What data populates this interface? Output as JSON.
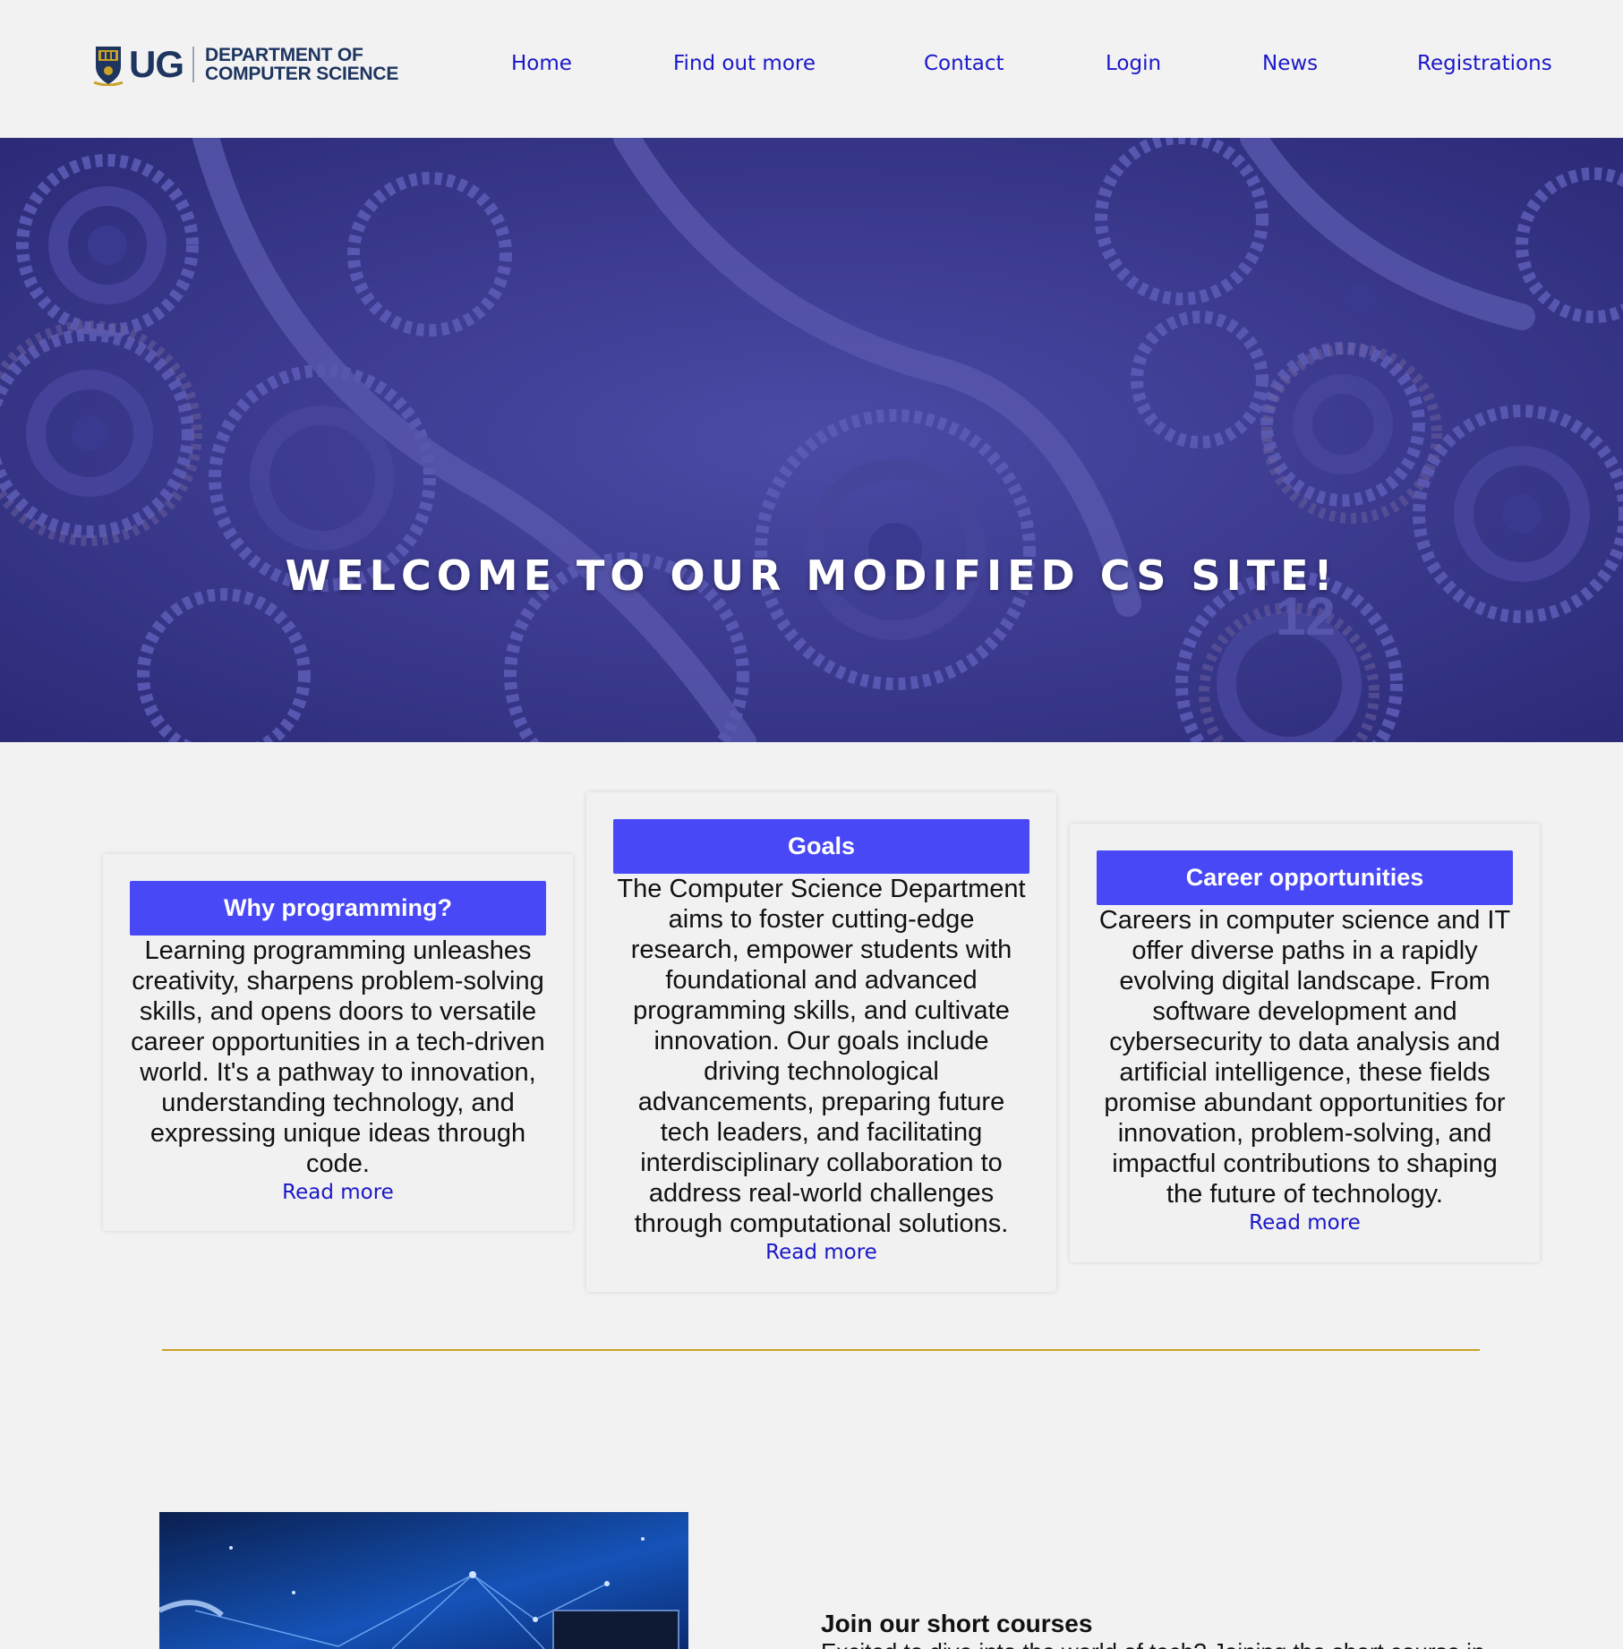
{
  "logo": {
    "mark": "UG",
    "line1": "DEPARTMENT OF",
    "line2": "COMPUTER SCIENCE",
    "crest_icon": "university-crest-icon"
  },
  "nav": {
    "items": [
      {
        "label": "Home"
      },
      {
        "label": "Find out more"
      },
      {
        "label": "Contact"
      },
      {
        "label": "Login"
      },
      {
        "label": "News"
      },
      {
        "label": "Registrations"
      }
    ]
  },
  "hero": {
    "title": "WELCOME TO OUR MODIFIED CS SITE!",
    "background": "gears-image"
  },
  "cards": [
    {
      "title": "Why programming?",
      "body": "Learning programming unleashes creativity, sharpens problem-solving skills, and opens doors to versatile career opportunities in a tech-driven world. It's a pathway to innovation, understanding technology, and expressing unique ideas through code.",
      "link": "Read more"
    },
    {
      "title": "Goals",
      "body": "The Computer Science Department aims to foster cutting-edge research, empower students with foundational and advanced programming skills, and cultivate innovation. Our goals include driving technological advancements, preparing future tech leaders, and facilitating interdisciplinary collaboration to address real-world challenges through computational solutions.",
      "link": "Read more"
    },
    {
      "title": "Career opportunities",
      "body": "Careers in computer science and IT offer diverse paths in a rapidly evolving digital landscape. From software development and cybersecurity to data analysis and artificial intelligence, these fields promise abundant opportunities for innovation, problem-solving, and impactful contributions to shaping the future of technology.",
      "link": "Read more"
    }
  ],
  "courses": {
    "title": "Join our short courses",
    "text": "Excited to dive into the world of tech? Joining the short course in"
  },
  "colors": {
    "accent": "#4848f7",
    "link": "#1a17c9",
    "hero_tint": "#3b3a8f",
    "divider": "#c9a227",
    "brand": "#1e3560"
  }
}
